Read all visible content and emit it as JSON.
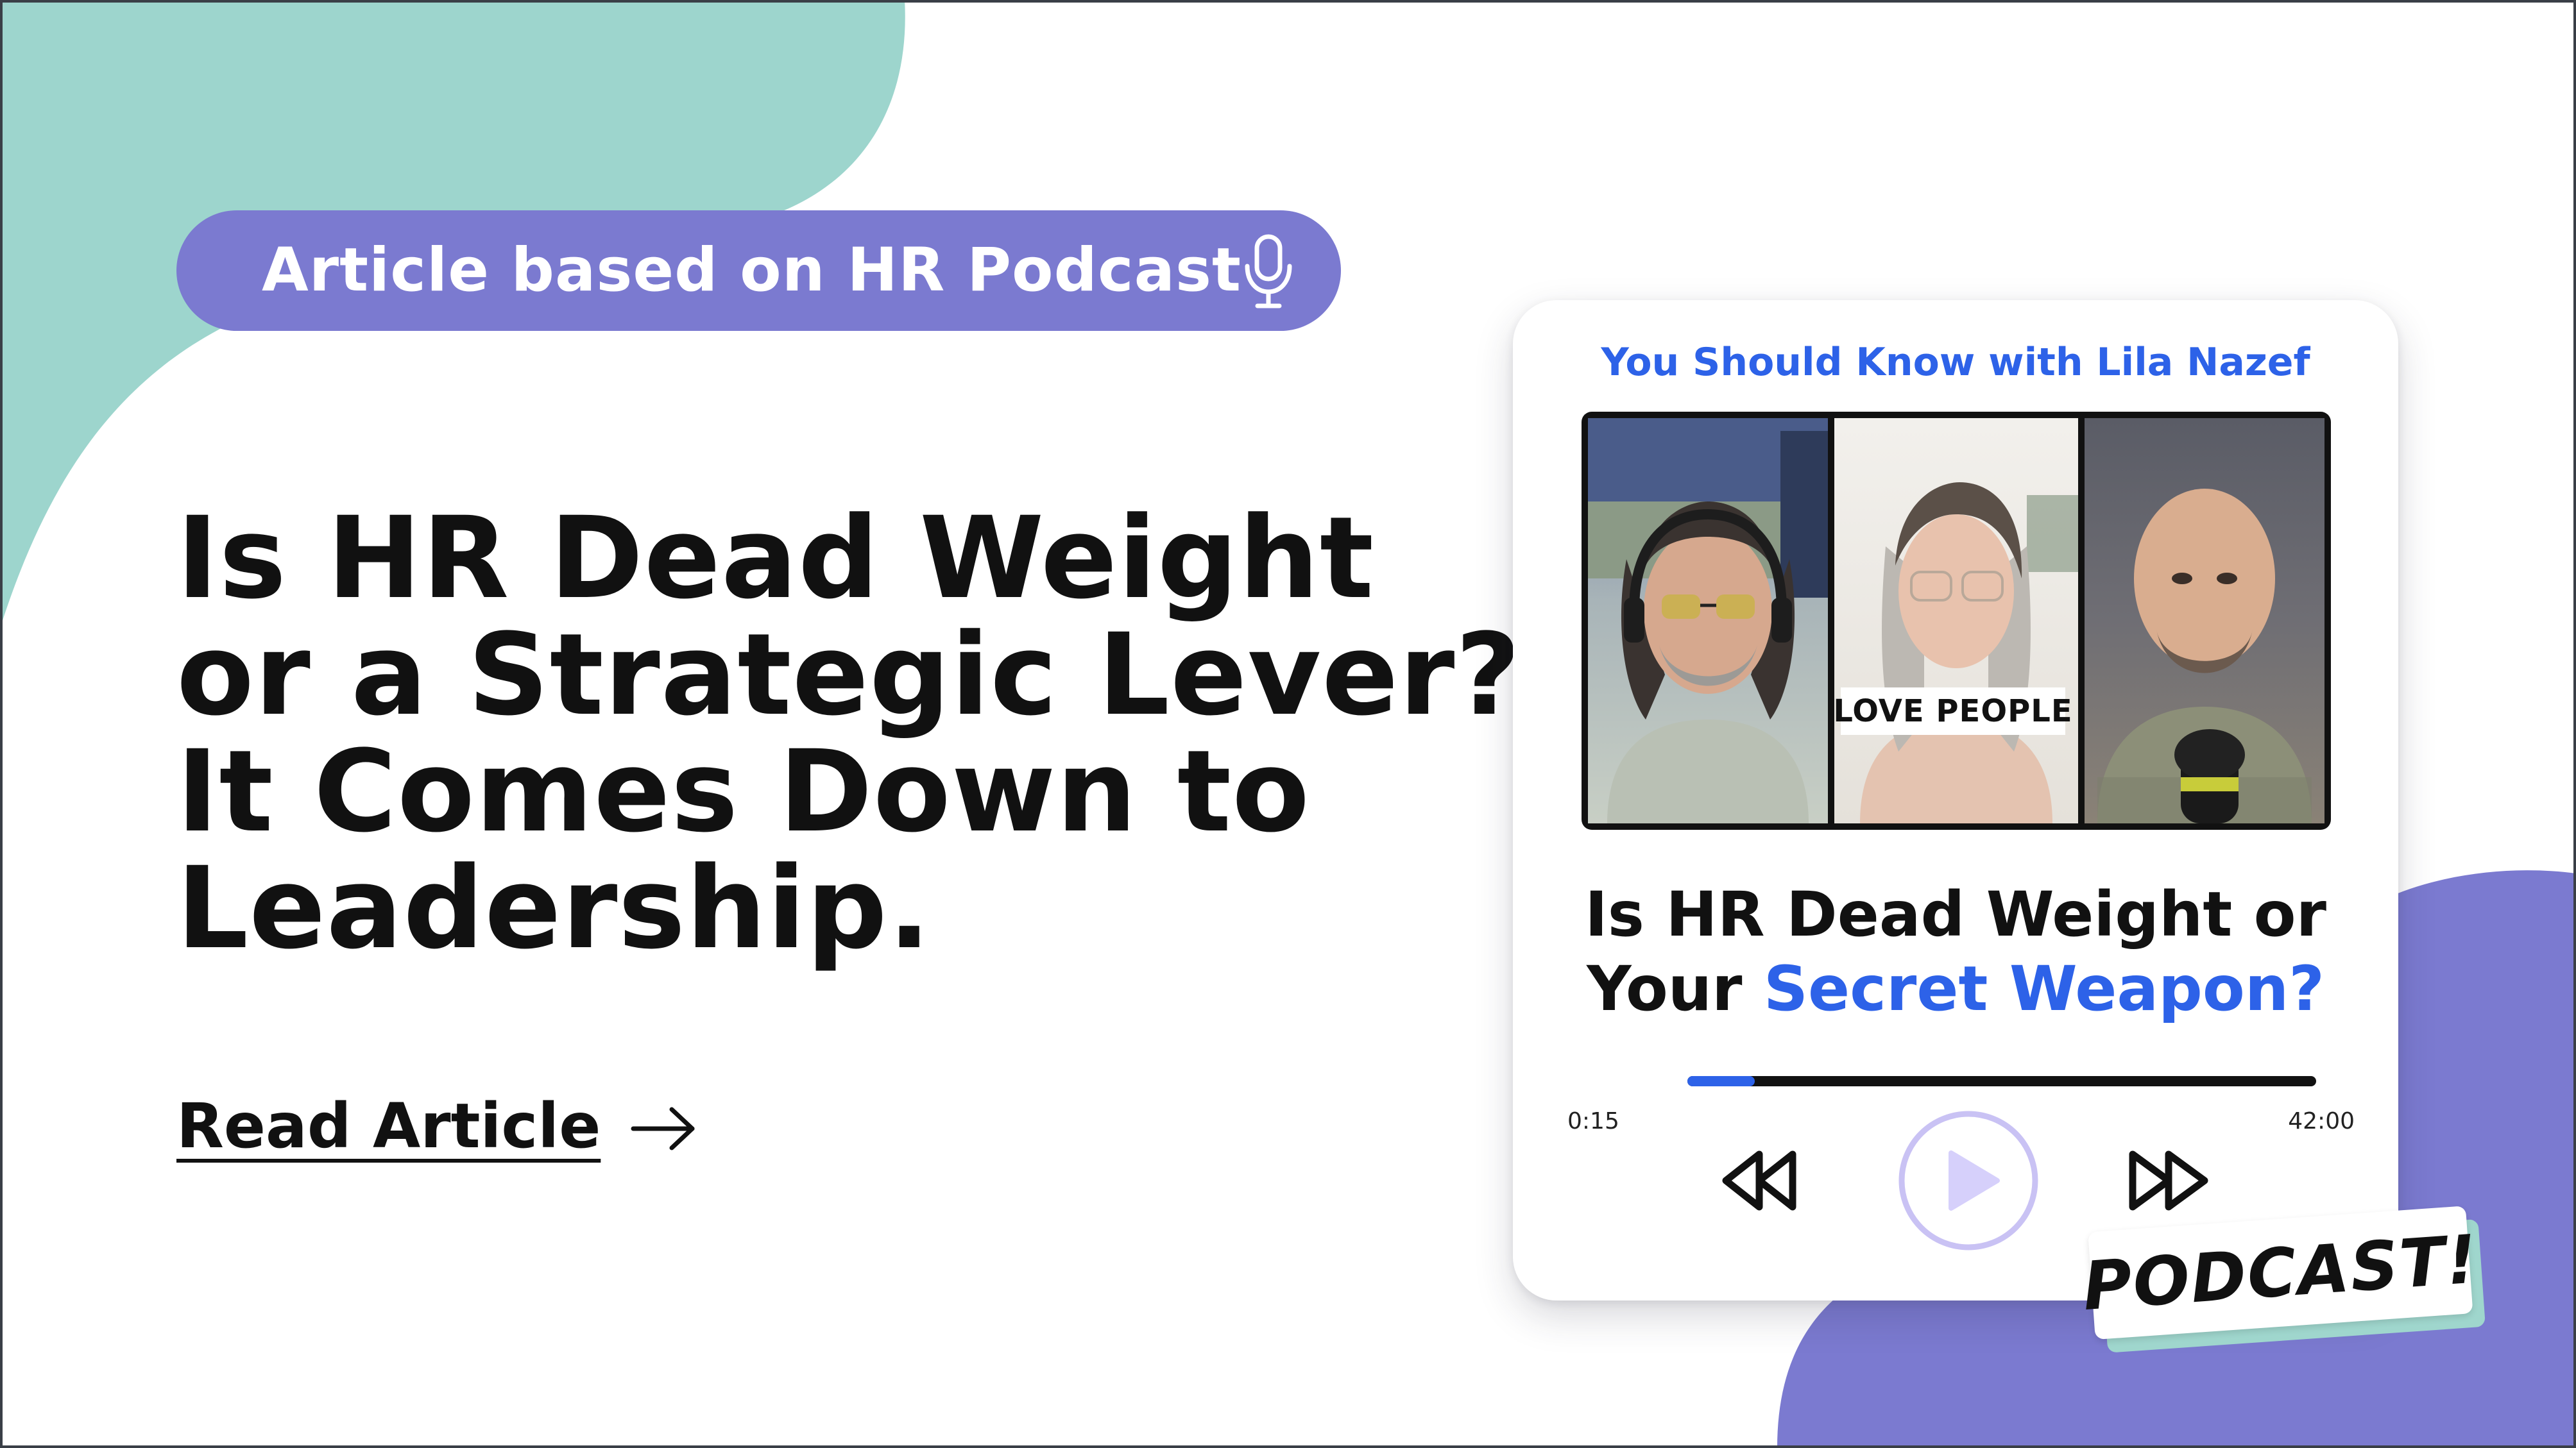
{
  "banner": {
    "tag_label": "Article based on HR Podcast",
    "headline_lines": [
      "Is HR Dead Weight",
      "or a Strategic Lever?",
      "It Comes Down to",
      "Leadership."
    ],
    "read_link_label": "Read Article"
  },
  "player": {
    "show_title": "You Should Know with Lila Nazef",
    "video_caption": "LOVE PEOPLE",
    "episode_title_line1": "Is HR Dead Weight or",
    "episode_title_line2_prefix": "Your ",
    "episode_title_line2_accent": "Secret Weapon?",
    "time_current": "0:15",
    "time_total": "42:00",
    "progress_fraction": 0.107,
    "sticker_label": "PODCAST!"
  },
  "icons": {
    "mic": "microphone-icon",
    "arrow": "arrow-right-icon",
    "rewind": "rewind-icon",
    "play": "play-icon",
    "forward": "fast-forward-icon"
  },
  "colors": {
    "teal_blob": "#9dd5cd",
    "purple": "#7b7ad0",
    "accent_blue": "#2d62e8",
    "play_ring": "#c9c2f4",
    "play_fill": "#d6d0fb",
    "text_dark": "#111111",
    "sticker_shadow": "#9fd6cd"
  }
}
